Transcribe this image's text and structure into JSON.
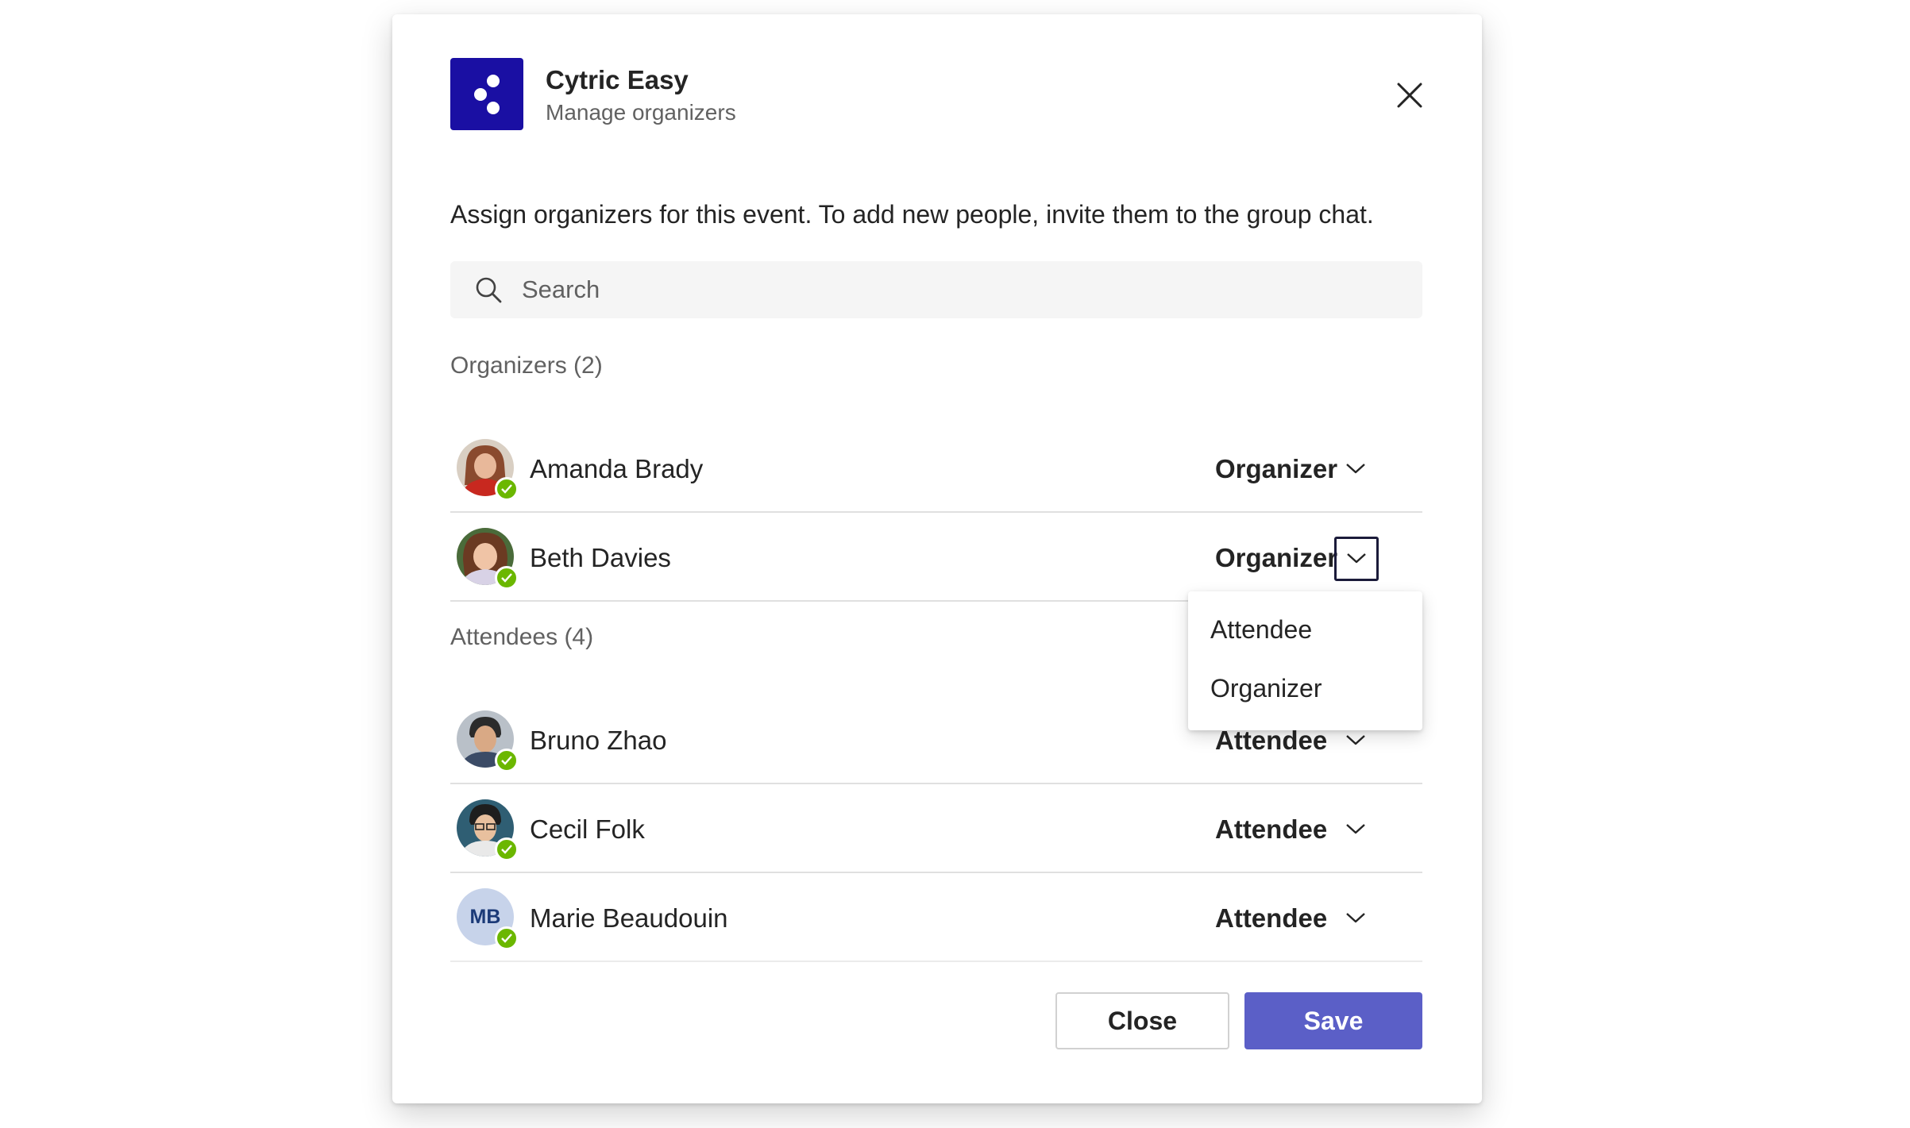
{
  "header": {
    "app_name": "Cytric Easy",
    "subtitle": "Manage organizers",
    "app_icon": "cytric-logo-icon",
    "close_icon": "close-icon"
  },
  "description": "Assign organizers for this event. To add new people, invite them to the group chat.",
  "search": {
    "placeholder": "Search",
    "value": "",
    "icon": "search-icon"
  },
  "organizers": {
    "label": "Organizers (2)",
    "people": [
      {
        "name": "Amanda Brady",
        "role": "Organizer",
        "status": "available"
      },
      {
        "name": "Beth Davies",
        "role": "Organizer",
        "status": "available"
      }
    ]
  },
  "attendees": {
    "label": "Attendees (4)",
    "people": [
      {
        "name": "Bruno Zhao",
        "role": "Attendee",
        "status": "available"
      },
      {
        "name": "Cecil Folk",
        "role": "Attendee",
        "status": "available"
      },
      {
        "name": "Marie Beaudouin",
        "initials": "MB",
        "role": "Attendee",
        "status": "available"
      }
    ]
  },
  "role_menu": {
    "options": [
      "Attendee",
      "Organizer"
    ]
  },
  "footer": {
    "close_label": "Close",
    "save_label": "Save"
  },
  "colors": {
    "brand": "#1a0fa3",
    "primary_button": "#5b5fc7",
    "presence_available": "#6bb700"
  }
}
